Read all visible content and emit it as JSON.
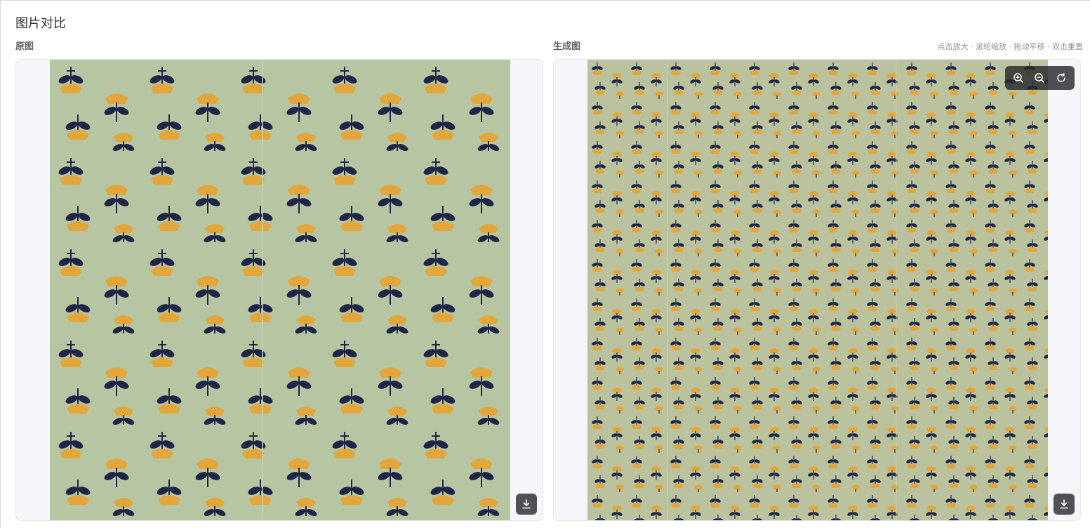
{
  "page": {
    "title": "图片对比"
  },
  "left_pane": {
    "label": "原图",
    "download_icon": "download-icon"
  },
  "right_pane": {
    "label": "生成图",
    "hint": "点击放大 · 滚轮缩放 · 拖动平移 · 双击重置",
    "toolbar": {
      "zoom_in_icon": "zoom-in-icon",
      "zoom_out_icon": "zoom-out-icon",
      "reset_icon": "rotate-reset-icon"
    },
    "download_icon": "download-icon"
  },
  "colors": {
    "fabric_original": "#b7c6a2",
    "fabric_generated": "#bac39d",
    "petal_yellow": "#e3a63a",
    "leaf_navy": "#1f2546"
  }
}
